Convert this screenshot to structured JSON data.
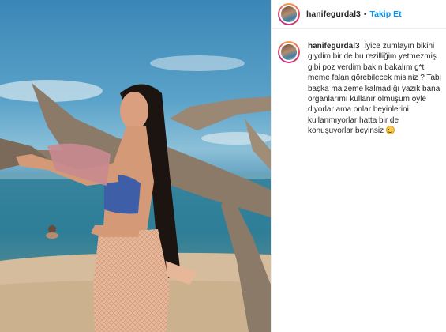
{
  "post": {
    "username": "hanifegurdal3",
    "separator": "•",
    "follow_label": "Takip Et",
    "caption_username": "hanifegurdal3",
    "caption_text": "İyice zumlayın bikini giydim bir de bu rezilliğim yetmezmiş gibi poz verdim bakın bakalım g*t meme falan görebilecek misiniz ? Tabi başka malzeme kalmadığı yazık bana organlarımı kullanır olmuşum öyle diyorlar ama onlar beyinlerini kullanmıyorlar hatta bir de konuşuyorlar beyinsiz",
    "caption_emoji": "smiling-face-emoji"
  },
  "colors": {
    "link_blue": "#0095f6",
    "text": "#262626",
    "border": "#efefef"
  }
}
